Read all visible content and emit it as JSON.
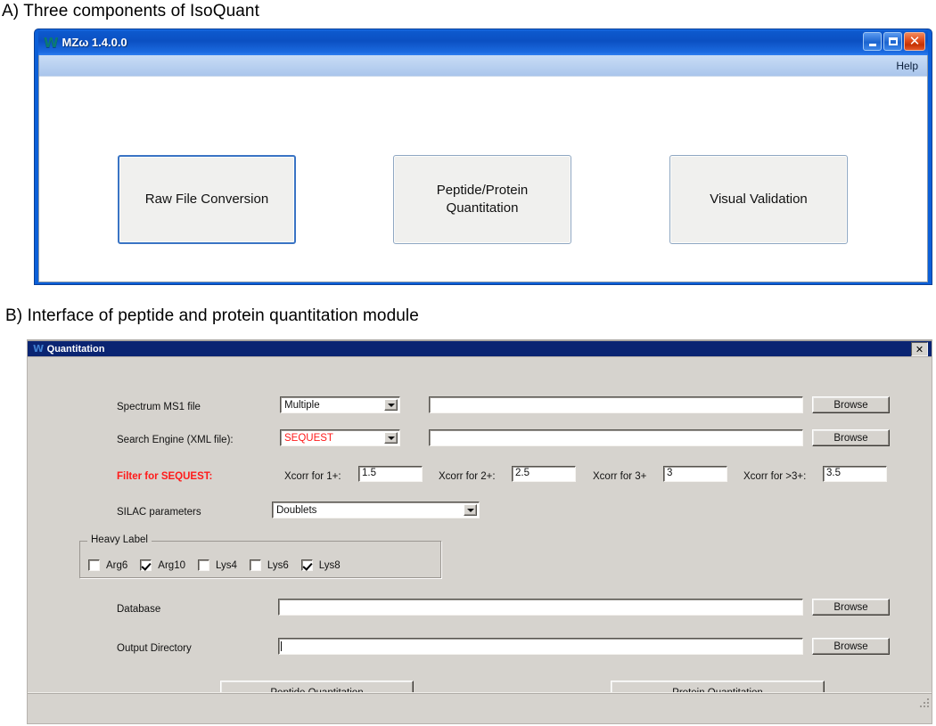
{
  "figure": {
    "panel_a_caption": "A) Three components of IsoQuant",
    "panel_b_caption": "B) Interface of peptide and protein quantitation module"
  },
  "colors": {
    "titlebar_blue": "#0b50c2",
    "titlebar_navy": "#0a2472",
    "dialog_face": "#d6d3ce",
    "alert_red": "#ff1a1a",
    "focus_border": "#3a74c4"
  },
  "main_window": {
    "logo": "W",
    "title": "MZω 1.4.0.0",
    "window_buttons": [
      "minimize",
      "maximize",
      "close"
    ],
    "menu": [
      {
        "label": "Help"
      }
    ],
    "buttons": [
      {
        "label": "Raw File Conversion",
        "focused": true
      },
      {
        "label": "Peptide/Protein\nQuantitation",
        "line1": "Peptide/Protein",
        "line2": "Quantitation",
        "focused": false
      },
      {
        "label": "Visual Validation",
        "focused": false
      }
    ]
  },
  "quant_dialog": {
    "logo": "W",
    "title": "Quantitation",
    "close_label": "✕",
    "rows": {
      "spectrum": {
        "label": "Spectrum MS1 file",
        "combo_value": "Multiple",
        "path_value": "",
        "browse_label": "Browse"
      },
      "search_engine": {
        "label": "Search Engine (XML file):",
        "combo_value": "SEQUEST",
        "combo_value_color": "#ff1a1a",
        "path_value": "",
        "browse_label": "Browse"
      },
      "filter": {
        "label": "Filter for SEQUEST:",
        "fields": [
          {
            "label": "Xcorr for 1+:",
            "value": "1.5"
          },
          {
            "label": "Xcorr for 2+:",
            "value": "2.5"
          },
          {
            "label": "Xcorr for 3+",
            "value": "3"
          },
          {
            "label": "Xcorr for >3+:",
            "value": "3.5"
          }
        ]
      },
      "silac": {
        "label": "SILAC parameters",
        "combo_value": "Doublets"
      },
      "heavy_label": {
        "legend": "Heavy Label",
        "checkboxes": [
          {
            "label": "Arg6",
            "checked": false
          },
          {
            "label": "Arg10",
            "checked": true
          },
          {
            "label": "Lys4",
            "checked": false
          },
          {
            "label": "Lys6",
            "checked": false
          },
          {
            "label": "Lys8",
            "checked": true
          }
        ]
      },
      "database": {
        "label": "Database",
        "value": "",
        "browse_label": "Browse"
      },
      "output_directory": {
        "label": "Output Directory",
        "value": "",
        "browse_label": "Browse"
      }
    },
    "action_buttons": [
      {
        "label": "Peptide Quantitation"
      },
      {
        "label": "Protein Quantitation"
      }
    ]
  }
}
